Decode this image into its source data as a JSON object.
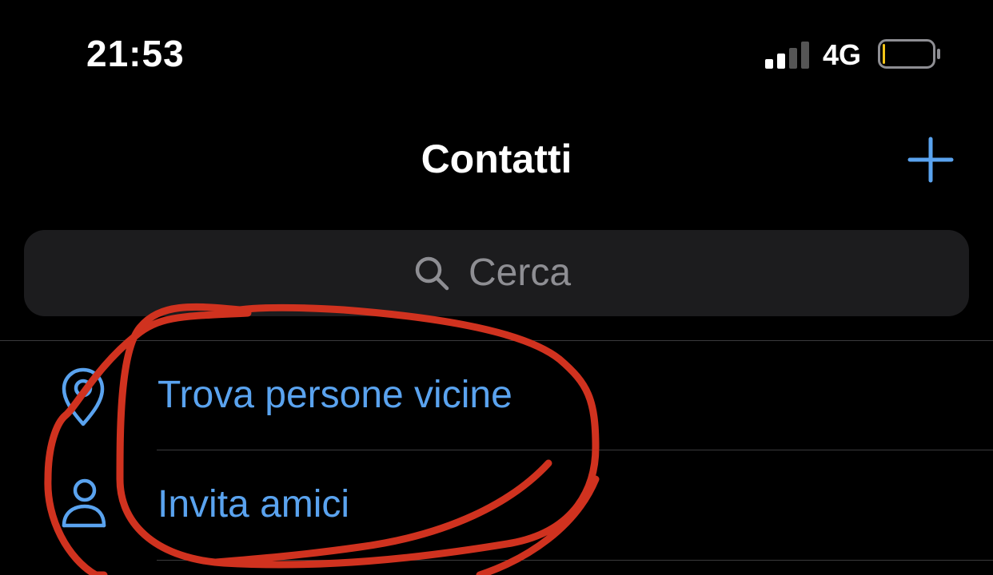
{
  "status_bar": {
    "time": "21:53",
    "network": "4G",
    "signal_icon": "cellular-signal-icon",
    "battery_icon": "battery-low-icon",
    "battery_level_fraction": 0.05
  },
  "nav": {
    "title": "Contatti",
    "add_icon": "plus-icon"
  },
  "search": {
    "placeholder": "Cerca",
    "icon": "magnifying-glass-icon"
  },
  "list": {
    "items": [
      {
        "label": "Trova persone vicine",
        "icon": "location-pin-icon"
      },
      {
        "label": "Invita amici",
        "icon": "person-invite-icon"
      }
    ]
  },
  "colors": {
    "background": "#000000",
    "accent": "#5aa3ef",
    "search_bg": "#1c1c1e",
    "annotation": "#d0321f"
  }
}
